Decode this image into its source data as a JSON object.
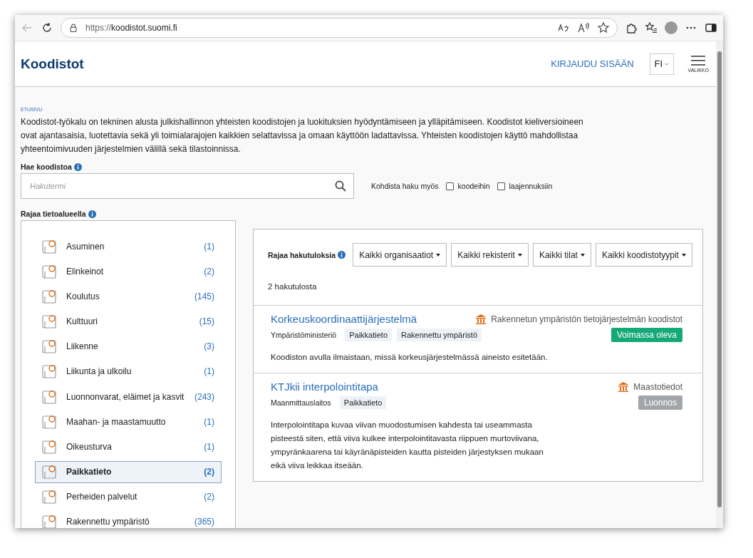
{
  "browser": {
    "url_scheme": "https://",
    "url_host": "koodistot.suomi.fi"
  },
  "header": {
    "logo": "Koodistot",
    "login": "KIRJAUDU SISÄÄN",
    "language": "FI",
    "menu_label": "VALIKKO"
  },
  "breadcrumb": "ETUSIVU",
  "intro": "Koodistot-työkalu on tekninen alusta julkishallinnon yhteisten koodistojen ja luokituksien hyödyntämiseen ja ylläpitämiseen. Koodistot kieliversioineen ovat ajantasaisia, luotettavia sekä yli toimialarajojen kaikkien selattavissa ja omaan käyttöön ladattavissa. Yhteisten koodistojen käyttö mahdollistaa yhteentoimivuuden järjestelmien välillä sekä tilastoinnissa.",
  "search": {
    "label": "Hae koodistoa",
    "placeholder": "Hakutermi",
    "target_label": "Kohdista haku myös",
    "options": [
      {
        "label": "koodeihin",
        "checked": false
      },
      {
        "label": "laajennuksiin",
        "checked": false
      }
    ]
  },
  "domains": {
    "label": "Rajaa tietoalueella",
    "items": [
      {
        "name": "Asuminen",
        "count": "(1)",
        "selected": false
      },
      {
        "name": "Elinkeinot",
        "count": "(2)",
        "selected": false
      },
      {
        "name": "Koulutus",
        "count": "(145)",
        "selected": false
      },
      {
        "name": "Kulttuuri",
        "count": "(15)",
        "selected": false
      },
      {
        "name": "Liikenne",
        "count": "(3)",
        "selected": false
      },
      {
        "name": "Liikunta ja ulkoilu",
        "count": "(1)",
        "selected": false
      },
      {
        "name": "Luonnonvarat, eläimet ja kasvit",
        "count": "(243)",
        "selected": false
      },
      {
        "name": "Maahan- ja maastamuutto",
        "count": "(1)",
        "selected": false
      },
      {
        "name": "Oikeusturva",
        "count": "(1)",
        "selected": false
      },
      {
        "name": "Paikkatieto",
        "count": "(2)",
        "selected": true
      },
      {
        "name": "Perheiden palvelut",
        "count": "(2)",
        "selected": false
      },
      {
        "name": "Rakennettu ympäristö",
        "count": "(365)",
        "selected": false
      }
    ]
  },
  "results": {
    "filter_label": "Rajaa hakutuloksia",
    "filters": [
      "Kaikki organisaatiot",
      "Kaikki rekisterit",
      "Kaikki tilat",
      "Kaikki koodistotyypit"
    ],
    "count": "2 hakutulosta",
    "items": [
      {
        "title": "Korkeuskoordinaattijärjestelmä",
        "registry": "Rakennetun ympäristön tietojärjestelmän koodistot",
        "organization": "Ympäristöministeriö",
        "tags": [
          "Paikkatieto",
          "Rakennettu ympäristö"
        ],
        "status": "Voimassa oleva",
        "kind": "valid",
        "description": "Koodiston avulla ilmaistaan, missä korkeusjärjestelmässä aineisto esitetään."
      },
      {
        "title": "KTJkii interpolointitapa",
        "registry": "Maastotiedot",
        "organization": "Maanmittauslaitos",
        "tags": [
          "Paikkatieto"
        ],
        "status": "Luonnos",
        "kind": "draft",
        "description": "Interpolointitapa kuvaa viivan muodostumisen kahdesta tai useammasta pisteestä siten, että viiva kulkee interpolointitavasta riippuen murtoviivana, ympyränkaarena tai käyränäpisteiden kautta pisteiden järjestyksen mukaan eikä viiva leikkaa itseään."
      }
    ]
  }
}
